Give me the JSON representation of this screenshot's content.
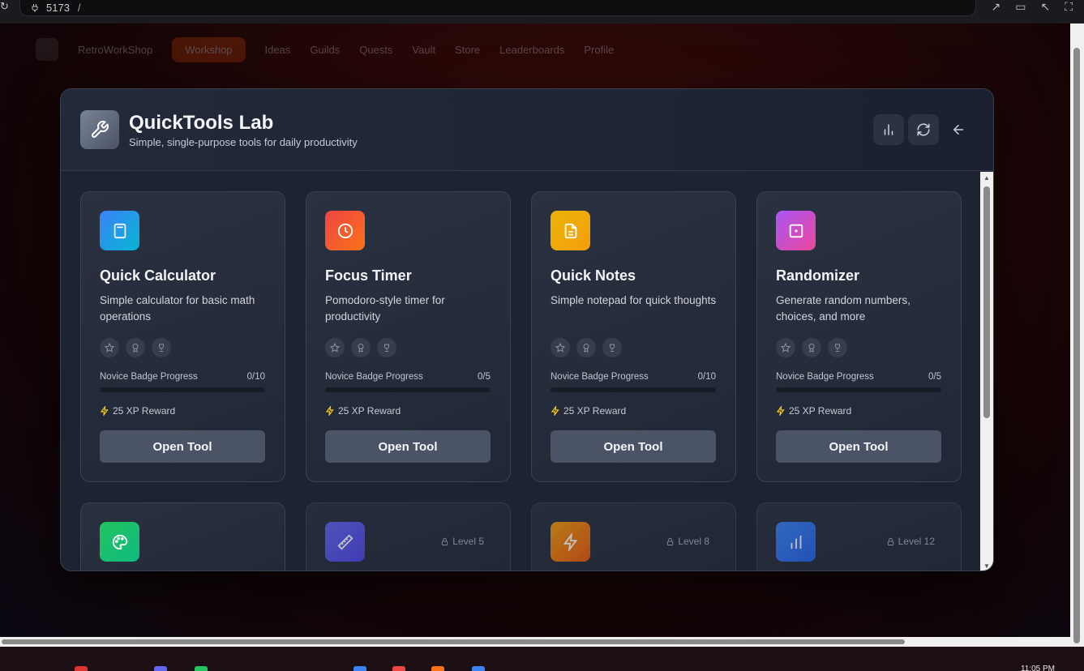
{
  "browser": {
    "port": "5173",
    "path": "/"
  },
  "app_nav": {
    "brand": "RetroWorkShop",
    "items": [
      "Workshop",
      "Ideas",
      "Guilds",
      "Quests",
      "Vault",
      "Store",
      "Leaderboards",
      "Profile"
    ]
  },
  "header": {
    "title": "QuickTools Lab",
    "subtitle": "Simple, single-purpose tools for daily productivity"
  },
  "tools": [
    {
      "name": "Quick Calculator",
      "description": "Simple calculator for basic math operations",
      "progress_label": "Novice Badge Progress",
      "progress_count": "0/10",
      "progress": 0,
      "xp": "25 XP Reward",
      "button": "Open Tool",
      "icon": "calculator-icon",
      "gradient": [
        "#3b82f6",
        "#06b6d4"
      ]
    },
    {
      "name": "Focus Timer",
      "description": "Pomodoro-style timer for productivity",
      "progress_label": "Novice Badge Progress",
      "progress_count": "0/5",
      "progress": 0,
      "xp": "25 XP Reward",
      "button": "Open Tool",
      "icon": "clock-icon",
      "gradient": [
        "#ef4444",
        "#f97316"
      ]
    },
    {
      "name": "Quick Notes",
      "description": "Simple notepad for quick thoughts",
      "progress_label": "Novice Badge Progress",
      "progress_count": "0/10",
      "progress": 0,
      "xp": "25 XP Reward",
      "button": "Open Tool",
      "icon": "document-icon",
      "gradient": [
        "#eab308",
        "#f59e0b"
      ]
    },
    {
      "name": "Randomizer",
      "description": "Generate random numbers, choices, and more",
      "progress_label": "Novice Badge Progress",
      "progress_count": "0/5",
      "progress": 0,
      "xp": "25 XP Reward",
      "button": "Open Tool",
      "icon": "dice-icon",
      "gradient": [
        "#a855f7",
        "#ec4899"
      ]
    }
  ],
  "tools_row2": [
    {
      "icon": "palette-icon",
      "lock_label": "",
      "gradient": [
        "#22c55e",
        "#10b981"
      ]
    },
    {
      "icon": "ruler-icon",
      "lock_label": "Level 5",
      "gradient": [
        "#6366f1",
        "#4f46e5"
      ]
    },
    {
      "icon": "bolt-icon",
      "lock_label": "Level 8",
      "gradient": [
        "#f59e0b",
        "#ea580c"
      ]
    },
    {
      "icon": "bar-chart-icon",
      "lock_label": "Level 12",
      "gradient": [
        "#3b82f6",
        "#2563eb"
      ]
    }
  ],
  "taskbar": {
    "clock": "11:05 PM"
  }
}
